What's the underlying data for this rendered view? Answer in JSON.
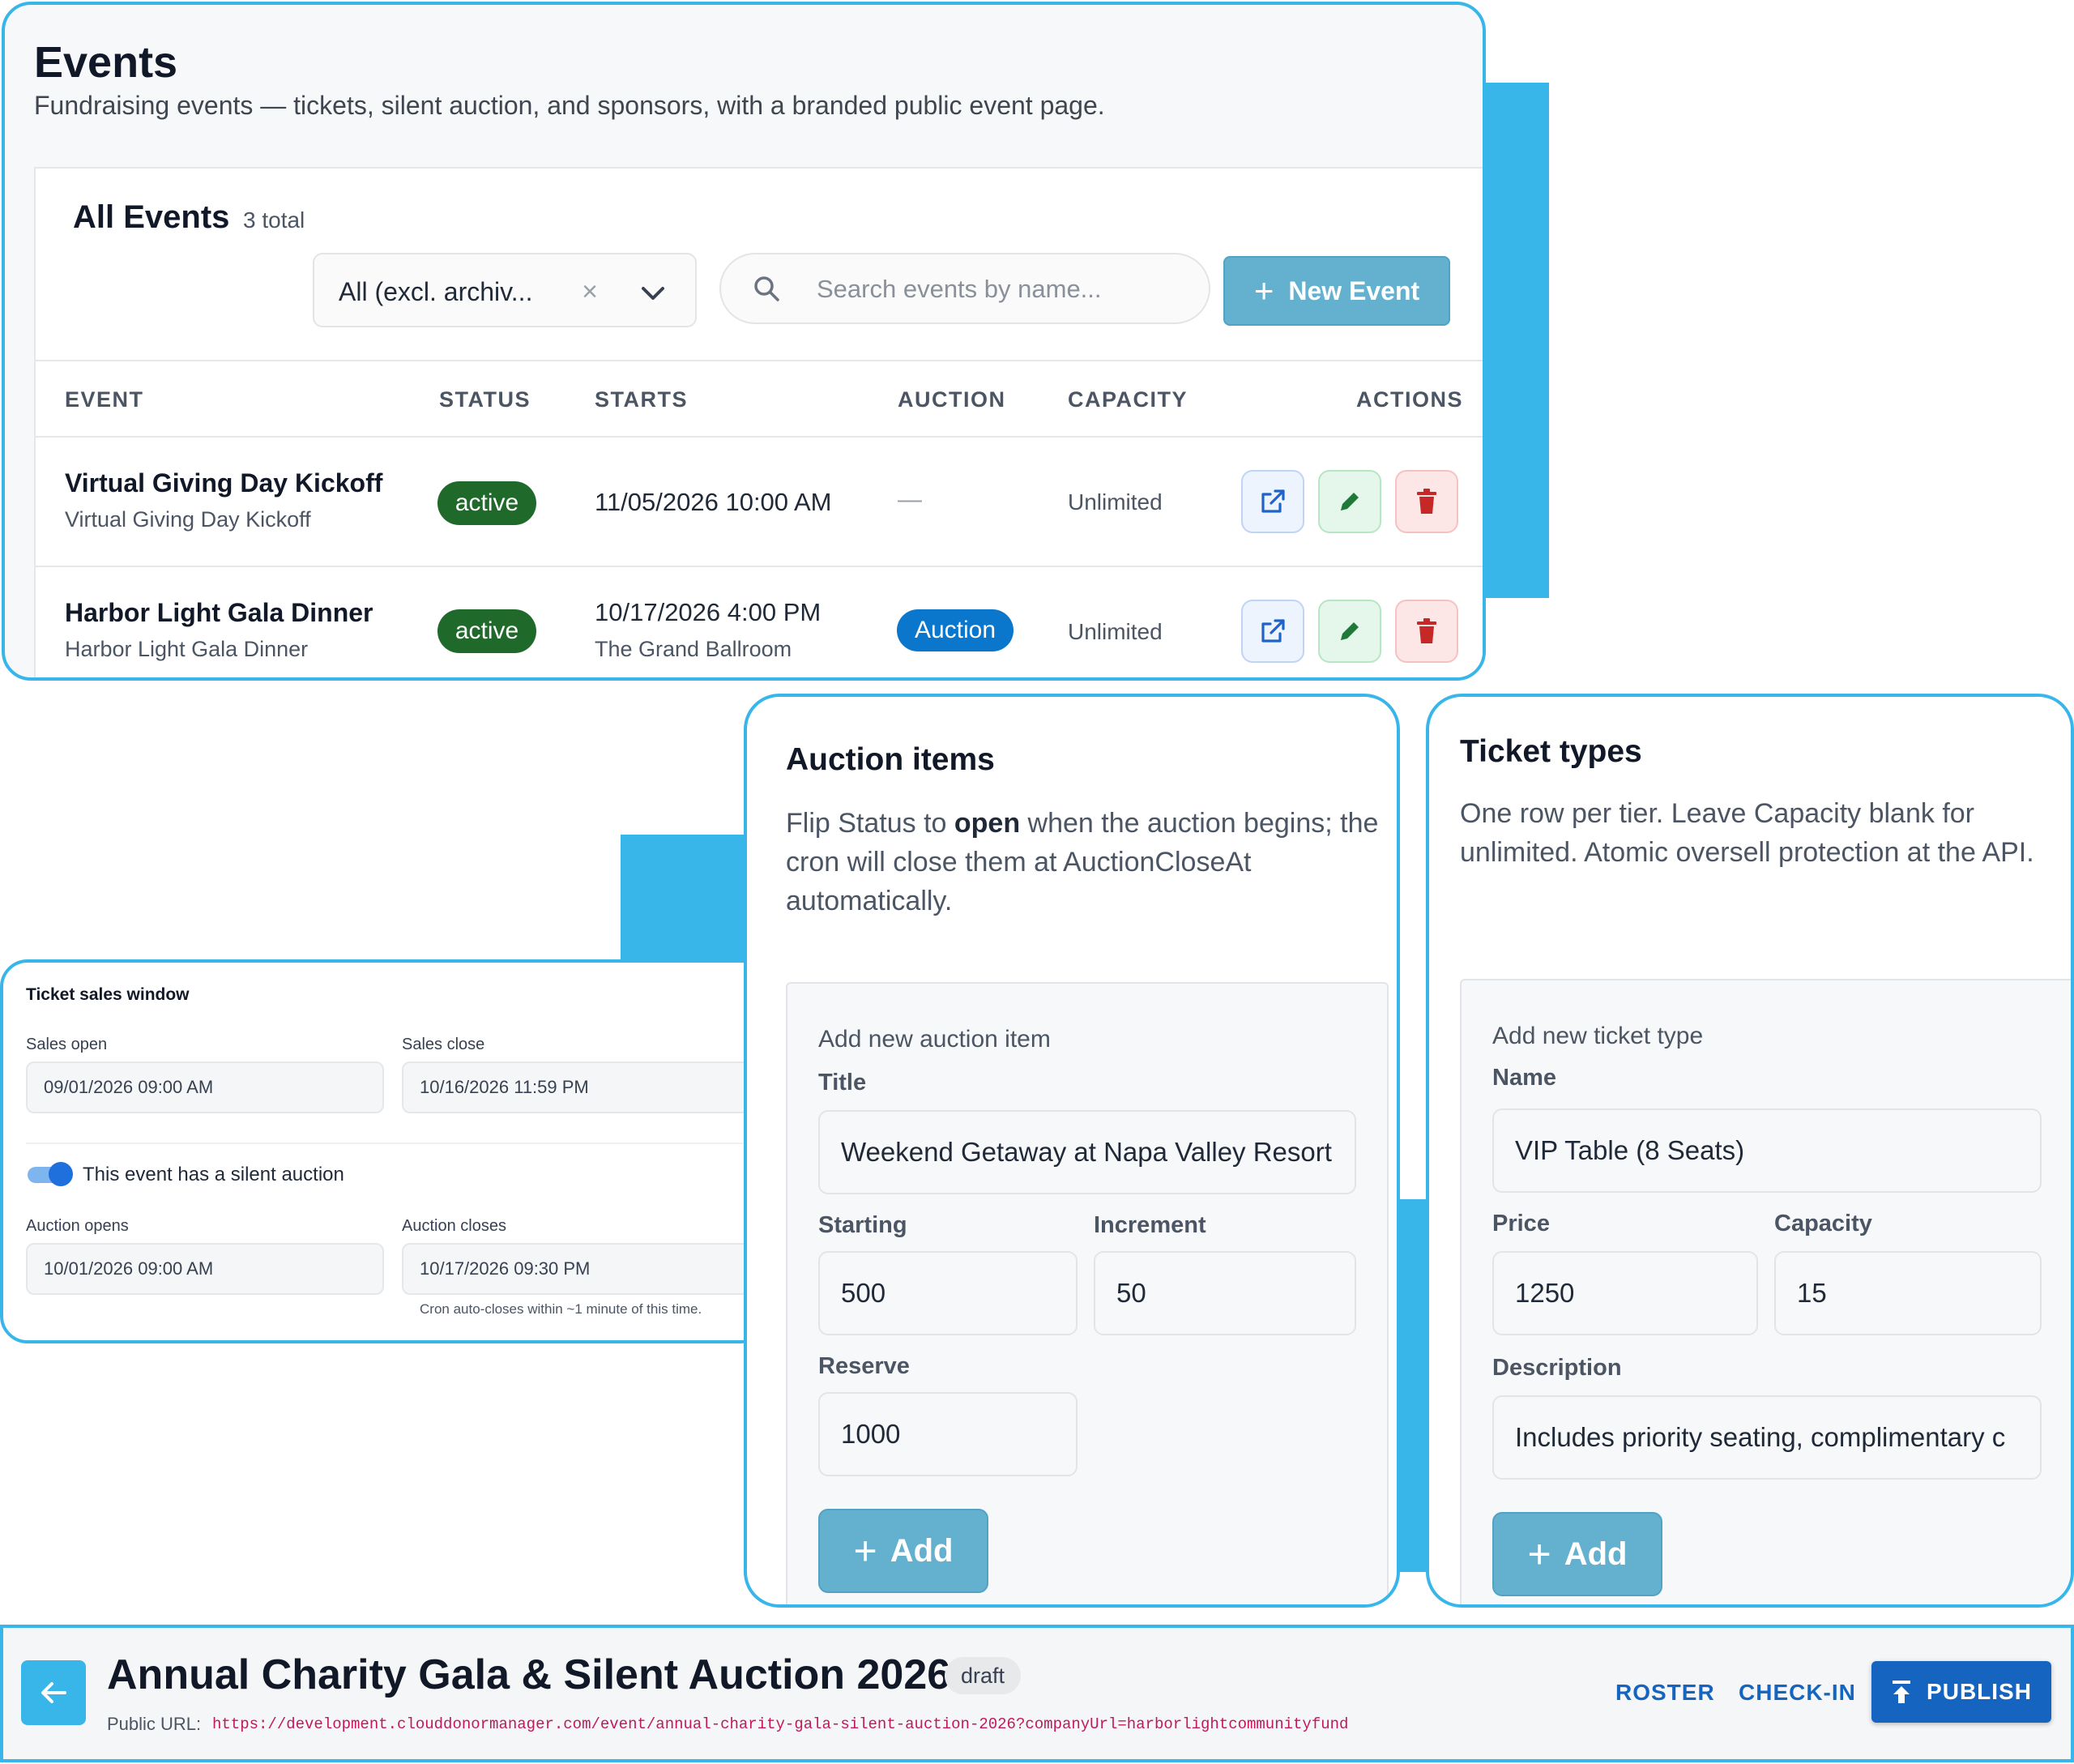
{
  "events": {
    "title": "Events",
    "subtitle": "Fundraising events — tickets, silent auction, and sponsors, with a branded public event page.",
    "card_title": "All Events",
    "count": "3 total",
    "filter_value": "All (excl. archiv...",
    "search_placeholder": "Search events by name...",
    "new_event_label": "New Event",
    "columns": {
      "event": "EVENT",
      "status": "STATUS",
      "starts": "STARTS",
      "auction": "AUCTION",
      "capacity": "CAPACITY",
      "actions": "ACTIONS"
    },
    "rows": [
      {
        "name": "Virtual Giving Day Kickoff",
        "subtitle": "Virtual Giving Day Kickoff",
        "status": "active",
        "starts": "11/05/2026 10:00 AM",
        "venue": "",
        "auction": "—",
        "capacity": "Unlimited"
      },
      {
        "name": "Harbor Light Gala Dinner",
        "subtitle": "Harbor Light Gala Dinner",
        "status": "active",
        "starts": "10/17/2026 4:00 PM",
        "venue": "The Grand Ballroom",
        "auction": "Auction",
        "capacity": "Unlimited"
      }
    ]
  },
  "sales_window": {
    "title": "Ticket sales window",
    "sales_open_label": "Sales open",
    "sales_open_value": "09/01/2026 09:00 AM",
    "sales_close_label": "Sales close",
    "sales_close_value": "10/16/2026 11:59 PM",
    "auction_toggle_label": "This event has a silent auction",
    "auction_toggle_on": true,
    "auction_opens_label": "Auction opens",
    "auction_opens_value": "10/01/2026 09:00 AM",
    "auction_closes_label": "Auction closes",
    "auction_closes_value": "10/17/2026 09:30 PM",
    "hint": "Cron auto-closes within ~1 minute of this time."
  },
  "auction_items": {
    "title": "Auction items",
    "desc_before": "Flip Status to ",
    "desc_bold": "open",
    "desc_after": " when the auction begins; the cron will close them at AuctionCloseAt automatically.",
    "form_title": "Add new auction item",
    "title_label": "Title",
    "title_value": "Weekend Getaway at Napa Valley Resort",
    "starting_label": "Starting",
    "starting_value": "500",
    "increment_label": "Increment",
    "increment_value": "50",
    "reserve_label": "Reserve",
    "reserve_value": "1000",
    "add_label": "Add"
  },
  "ticket_types": {
    "title": "Ticket types",
    "desc": "One row per tier. Leave Capacity blank for unlimited. Atomic oversell protection at the API.",
    "form_title": "Add new ticket type",
    "name_label": "Name",
    "name_value": "VIP Table (8 Seats)",
    "price_label": "Price",
    "price_value": "1250",
    "capacity_label": "Capacity",
    "capacity_value": "15",
    "description_label": "Description",
    "description_value": "Includes priority seating, complimentary c",
    "add_label": "Add"
  },
  "event_header": {
    "title": "Annual Charity Gala & Silent Auction 2026",
    "status": "draft",
    "url_label": "Public URL:",
    "url": "https://development.clouddonormanager.com/event/annual-charity-gala-silent-auction-2026?companyUrl=harborlightcommunityfund",
    "roster_label": "ROSTER",
    "checkin_label": "CHECK-IN",
    "publish_label": "PUBLISH"
  },
  "colors": {
    "accent": "#38b6ea",
    "active_badge": "#1f6a2a",
    "auction_badge": "#0b77cc",
    "primary": "#1565c0",
    "add_button": "#63b0cf"
  }
}
